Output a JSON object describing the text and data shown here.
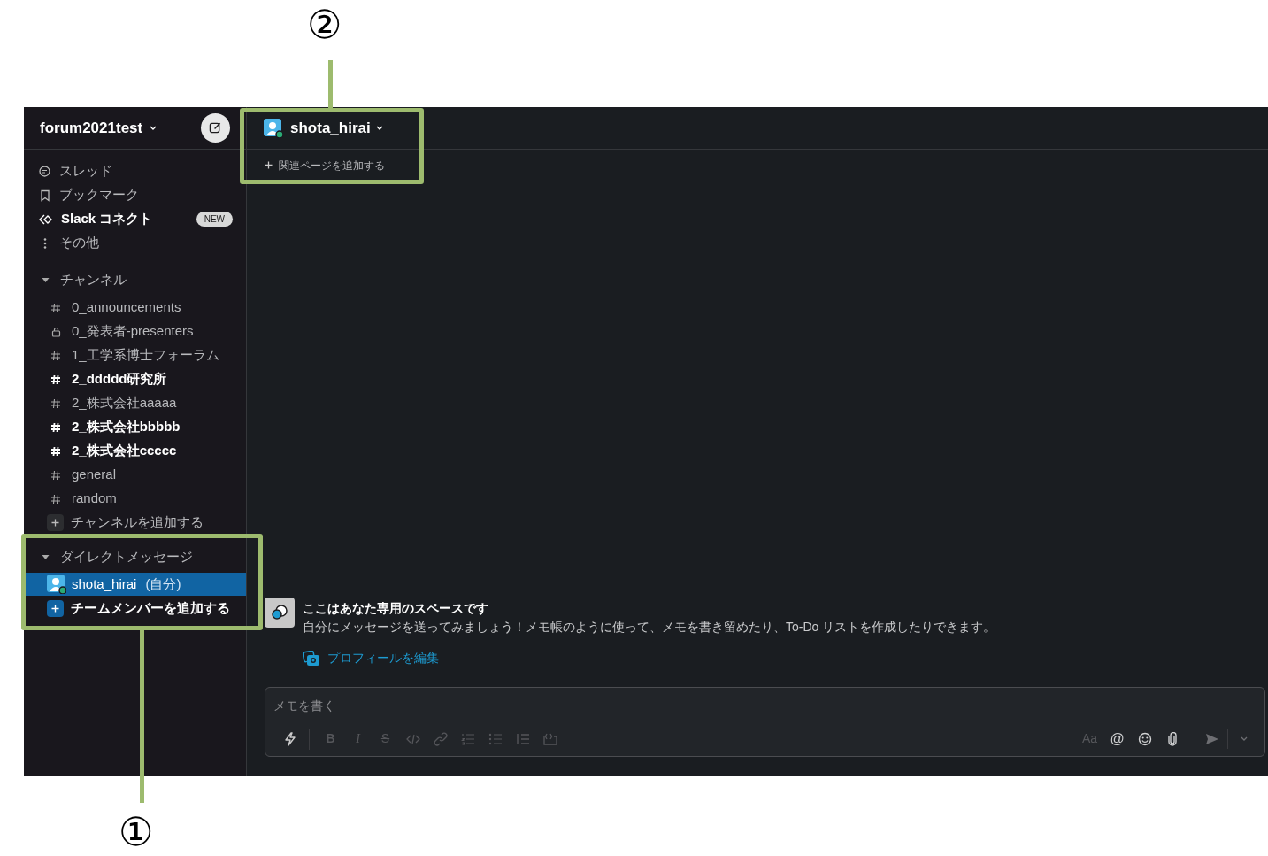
{
  "annotations": [
    {
      "label": "②"
    },
    {
      "label": "①"
    }
  ],
  "workspace": {
    "name": "forum2021test"
  },
  "nav_items": [
    {
      "kind": "threads",
      "label": "スレッド",
      "unread": false
    },
    {
      "kind": "bookmarks",
      "label": "ブックマーク",
      "unread": false
    },
    {
      "kind": "connect",
      "label": "Slack コネクト",
      "unread": true,
      "badge": "NEW"
    },
    {
      "kind": "more",
      "label": "その他",
      "unread": false
    }
  ],
  "channels": {
    "title": "チャンネル",
    "expanded": true,
    "items": [
      {
        "kind": "public",
        "name": "0_announcements",
        "unread": false
      },
      {
        "kind": "private",
        "name": "0_発表者-presenters",
        "unread": false
      },
      {
        "kind": "public",
        "name": "1_工学系博士フォーラム",
        "unread": false
      },
      {
        "kind": "public",
        "name": "2_ddddd研究所",
        "unread": true
      },
      {
        "kind": "public",
        "name": "2_株式会社aaaaa",
        "unread": false
      },
      {
        "kind": "public",
        "name": "2_株式会社bbbbb",
        "unread": true
      },
      {
        "kind": "public",
        "name": "2_株式会社ccccc",
        "unread": true
      },
      {
        "kind": "public",
        "name": "general",
        "unread": false
      },
      {
        "kind": "public",
        "name": "random",
        "unread": false
      }
    ],
    "add_label": "チャンネルを追加する"
  },
  "direct_messages": {
    "title": "ダイレクトメッセージ",
    "expanded": true,
    "items": [
      {
        "name": "shota_hirai",
        "suffix": "(自分)",
        "selected": true
      }
    ],
    "add_label": "チームメンバーを追加する"
  },
  "header": {
    "name": "shota_hirai",
    "add_page": "関連ページを追加する"
  },
  "intro": {
    "title": "ここはあなた専用のスペースです",
    "body": "自分にメッセージを送ってみましょう！メモ帳のように使って、メモを書き留めたり、To-Do リストを作成したりできます。",
    "link": "プロフィールを編集"
  },
  "composer": {
    "placeholder": "メモを書く",
    "format_buttons": [
      {
        "label": "B",
        "kind": "bold",
        "disabled": true
      },
      {
        "label": "I",
        "kind": "italic",
        "disabled": true
      },
      {
        "label": "S",
        "kind": "strike",
        "disabled": true
      }
    ],
    "font_button": {
      "label": "Aa",
      "disabled": true
    },
    "mention_button": {
      "label": "@"
    }
  }
}
